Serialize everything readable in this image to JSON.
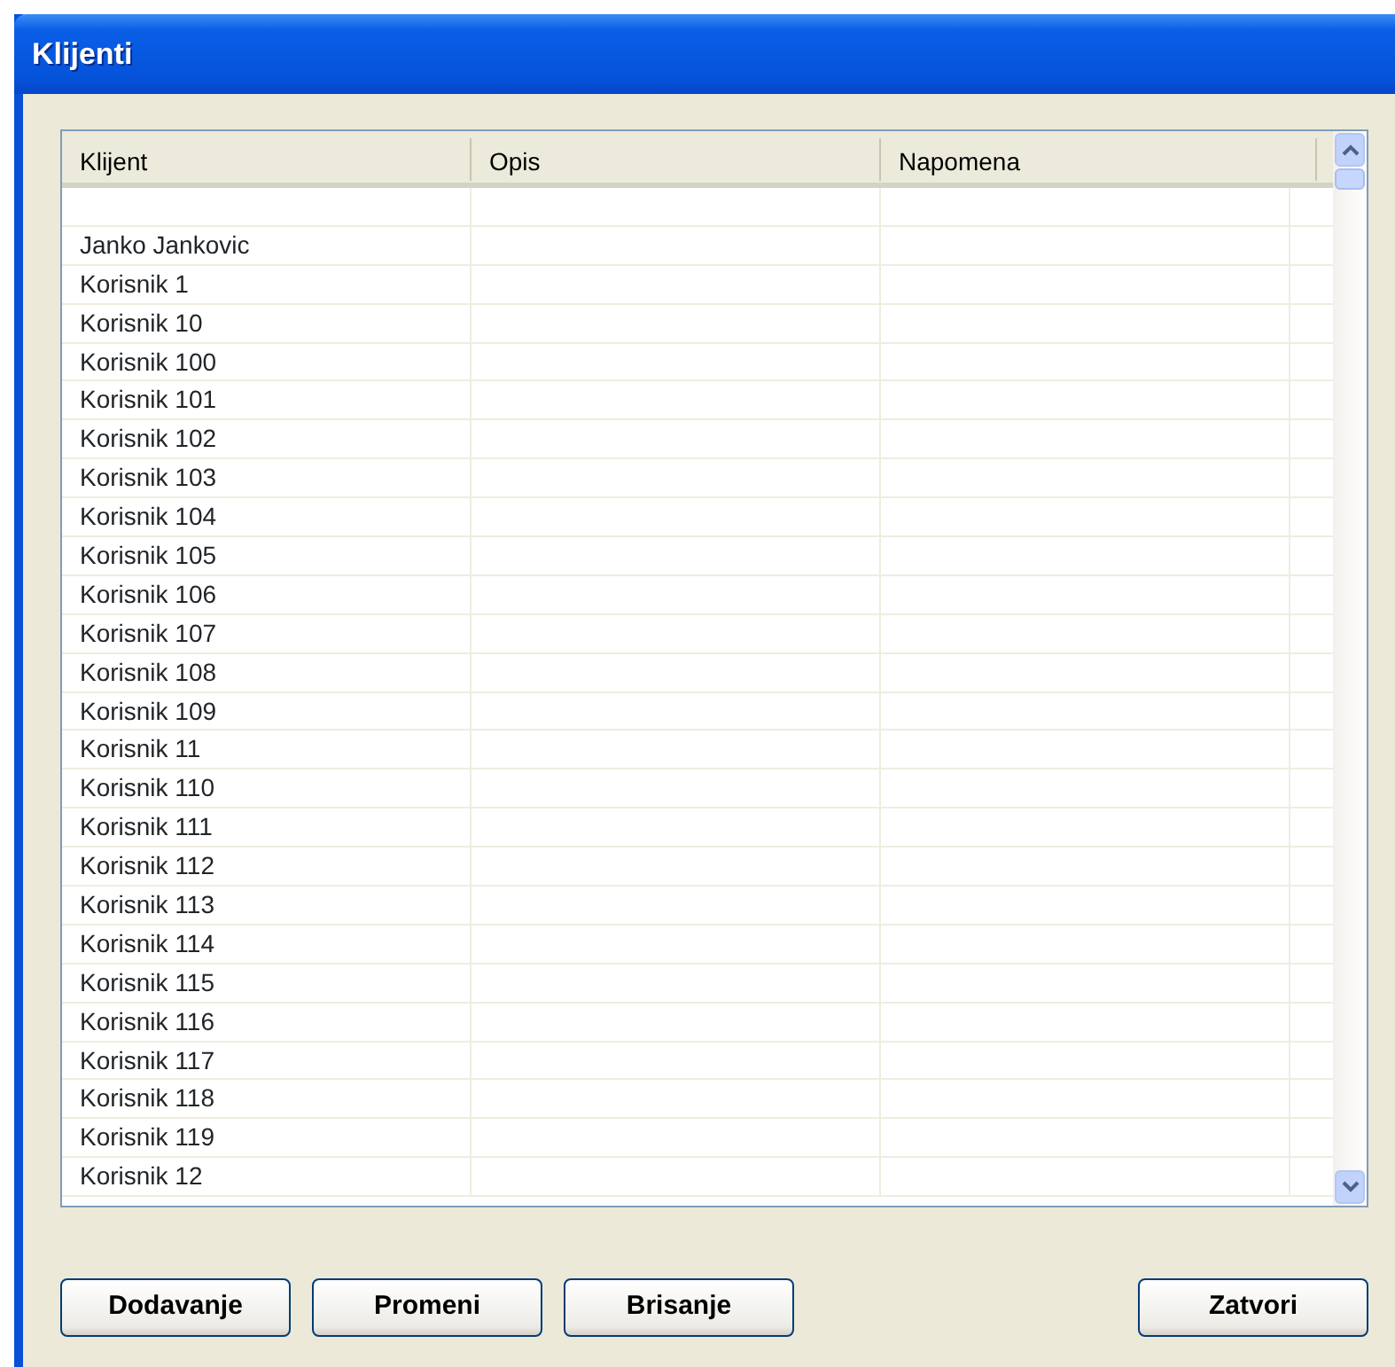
{
  "window": {
    "title": "Klijenti"
  },
  "table": {
    "columns": [
      "Klijent",
      "Opis",
      "Napomena"
    ],
    "rows": [
      {},
      {
        "klijent": "Janko Jankovic"
      },
      {
        "klijent": "Korisnik 1"
      },
      {
        "klijent": "Korisnik 10"
      },
      {
        "klijent": "Korisnik 100"
      },
      {
        "klijent": "Korisnik 101"
      },
      {
        "klijent": "Korisnik 102"
      },
      {
        "klijent": "Korisnik 103"
      },
      {
        "klijent": "Korisnik 104"
      },
      {
        "klijent": "Korisnik 105"
      },
      {
        "klijent": "Korisnik 106"
      },
      {
        "klijent": "Korisnik 107"
      },
      {
        "klijent": "Korisnik 108"
      },
      {
        "klijent": "Korisnik 109"
      },
      {
        "klijent": "Korisnik 11"
      },
      {
        "klijent": "Korisnik 110"
      },
      {
        "klijent": "Korisnik 111"
      },
      {
        "klijent": "Korisnik 112"
      },
      {
        "klijent": "Korisnik 113"
      },
      {
        "klijent": "Korisnik 114"
      },
      {
        "klijent": "Korisnik 115"
      },
      {
        "klijent": "Korisnik 116"
      },
      {
        "klijent": "Korisnik 117"
      },
      {
        "klijent": "Korisnik 118"
      },
      {
        "klijent": "Korisnik 119"
      },
      {
        "klijent": "Korisnik 12"
      }
    ]
  },
  "buttons": [
    {
      "label": "Dodavanje",
      "kind": "left"
    },
    {
      "label": "Promeni",
      "kind": "left"
    },
    {
      "label": "Brisanje",
      "kind": "left"
    },
    {
      "label": "Zatvori",
      "kind": "right"
    }
  ]
}
